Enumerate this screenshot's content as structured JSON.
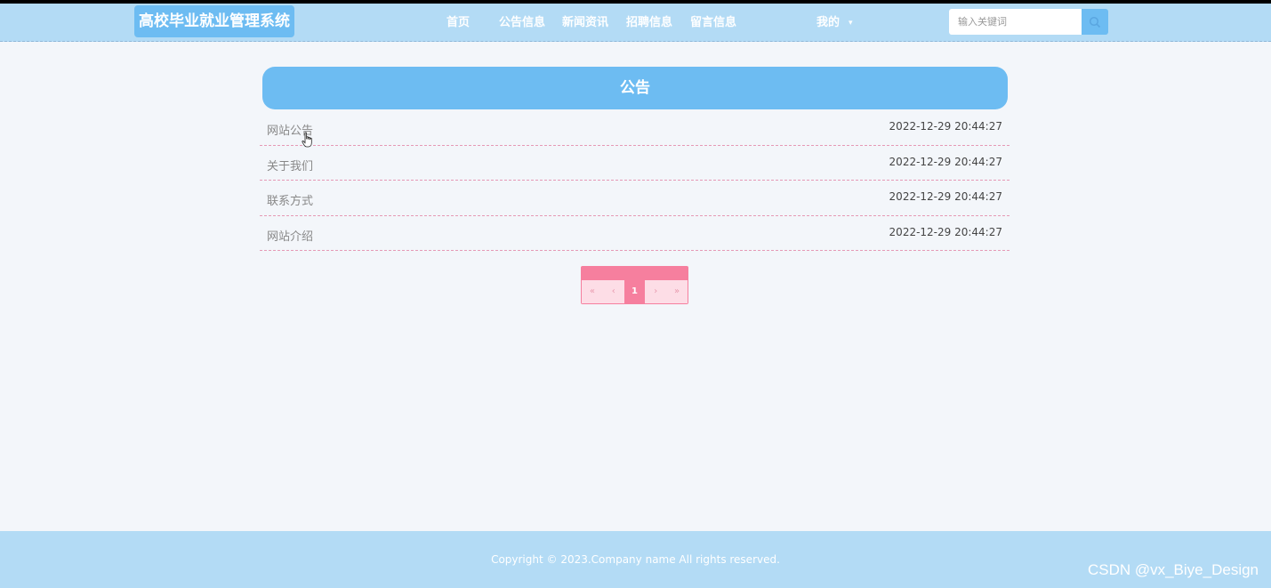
{
  "header": {
    "logo": "高校毕业就业管理系统",
    "nav": [
      {
        "label": "首页"
      },
      {
        "label": "公告信息"
      },
      {
        "label": "新闻资讯"
      },
      {
        "label": "招聘信息"
      },
      {
        "label": "留言信息"
      }
    ],
    "mine_label": "我的",
    "search_placeholder": "输入关键词",
    "icons": {
      "search": "search-icon",
      "caret": "caret-down-icon"
    }
  },
  "panel": {
    "title": "公告",
    "items": [
      {
        "title": "网站公告",
        "time": "2022-12-29 20:44:27"
      },
      {
        "title": "关于我们",
        "time": "2022-12-29 20:44:27"
      },
      {
        "title": "联系方式",
        "time": "2022-12-29 20:44:27"
      },
      {
        "title": "网站介绍",
        "time": "2022-12-29 20:44:27"
      }
    ]
  },
  "pagination": {
    "first": "«",
    "prev": "‹",
    "current": "1",
    "next": "›",
    "last": "»"
  },
  "footer": {
    "copyright": "Copyright © 2023.Company name All rights reserved.",
    "watermark": "CSDN @vx_Biye_Design"
  },
  "colors": {
    "header_bg": "#b3dbf5",
    "accent_blue": "#6dbcf2",
    "accent_pink": "#f67f9e",
    "page_bg": "#f3f6fa"
  }
}
